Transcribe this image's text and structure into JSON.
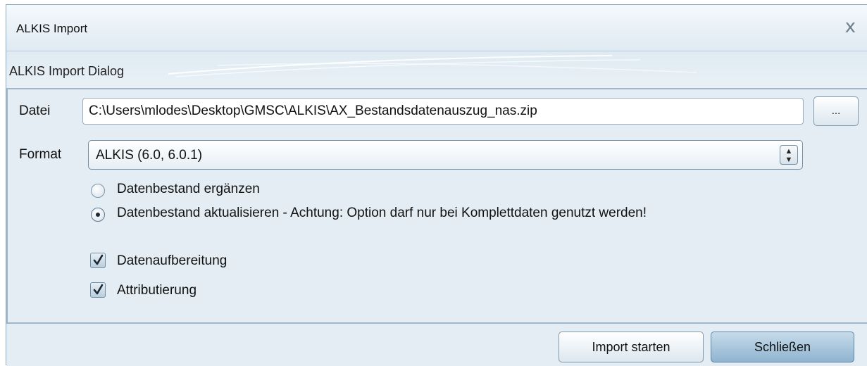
{
  "window": {
    "title": "ALKIS Import",
    "close_glyph": "x"
  },
  "dialog": {
    "title": "ALKIS Import Dialog"
  },
  "file": {
    "label": "Datei",
    "value": "C:\\Users\\mlodes\\Desktop\\GMSC\\ALKIS\\AX_Bestandsdatenauszug_nas.zip",
    "browse_label": "..."
  },
  "format": {
    "label": "Format",
    "selected": "ALKIS (6.0, 6.0.1)",
    "arrow": "▲\n▼"
  },
  "mode_options": [
    {
      "label": "Datenbestand ergänzen",
      "selected": false
    },
    {
      "label": "Datenbestand aktualisieren - Achtung: Option darf nur bei Komplettdaten genutzt werden!",
      "selected": true
    }
  ],
  "checkboxes": [
    {
      "label": "Datenaufbereitung",
      "checked": true
    },
    {
      "label": "Attributierung",
      "checked": true
    }
  ],
  "footer": {
    "start_label": "Import starten",
    "close_label": "Schließen"
  }
}
